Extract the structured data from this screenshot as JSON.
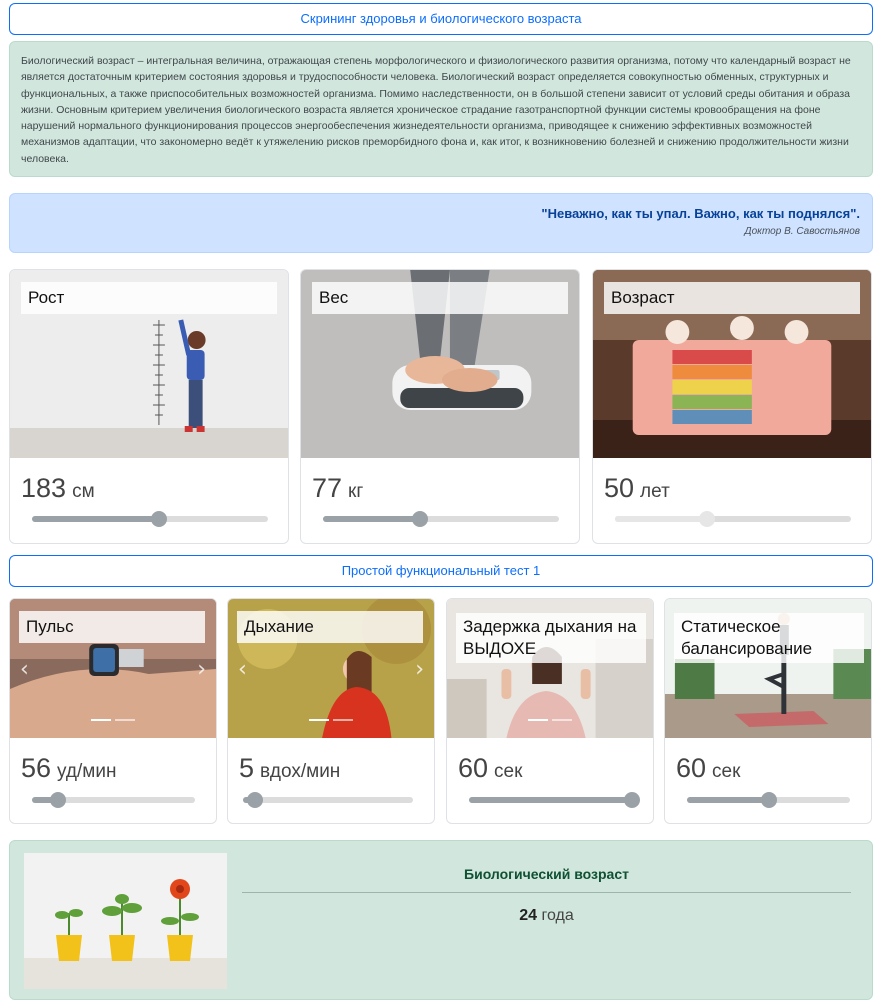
{
  "header": {
    "screening_button": "Скрининг здоровья и биологического возраста",
    "info_text": "Биологический возраст – интегральная величина, отражающая степень морфологического и физиологического развития организма, потому что календарный возраст не является достаточным критерием состояния здоровья и трудоспособности человека. Биологический возраст определяется совокупностью обменных, структурных и функциональных, а также приспособительных возможностей организма. Помимо наследственности, он в большой степени зависит от условий среды обитания и образа жизни. Основным критерием увеличения биологического возраста является хроническое страдание газотранспортной функции системы кровообращения на фоне нарушений нормального функционирования процессов энергообеспечения жизнедеятельности организма, приводящее к снижению эффективных возможностей механизмов адаптации, что закономерно ведёт к утяжелению рисков преморбидного фона и, как итог, к возникновению болезней и снижению продолжительности жизни человека."
  },
  "quote": {
    "text": "\"Неважно, как ты упал. Важно, как ты поднялся\".",
    "author": "Доктор В. Савостьянов"
  },
  "metrics": [
    {
      "label": "Рост",
      "value": "183",
      "unit": "см",
      "slider_fraction": 0.54,
      "image": "child-measuring-height-photo"
    },
    {
      "label": "Вес",
      "value": "77",
      "unit": "кг",
      "slider_fraction": 0.41,
      "image": "feet-on-scale-photo"
    },
    {
      "label": "Возраст",
      "value": "50",
      "unit": "лет",
      "slider_fraction": 0.39,
      "image": "rainbow-cake-photo"
    }
  ],
  "functional_test": {
    "button": "Простой функциональный тест 1",
    "items": [
      {
        "label": "Пульс",
        "value": "56",
        "unit": "уд/мин",
        "slider_fraction": 0.16,
        "image": "smartwatch-pulse-photo"
      },
      {
        "label": "Дыхание",
        "value": "5",
        "unit": "вдох/мин",
        "slider_fraction": 0.07,
        "image": "woman-breathing-photo"
      },
      {
        "label": "Задержка дыхания на ВЫДОХЕ",
        "value": "60",
        "unit": "сек",
        "slider_fraction": 1.0,
        "image": "woman-holding-breath-photo"
      },
      {
        "label": "Статическое балансирование",
        "value": "60",
        "unit": "сек",
        "slider_fraction": 0.5,
        "image": "yoga-balance-photo"
      }
    ]
  },
  "result": {
    "title": "Биологический возраст",
    "value": "24",
    "unit": "года",
    "image": "flowers-in-pots-photo"
  },
  "colors": {
    "primary": "#0d6efd",
    "success_bg": "#d1e7dd",
    "info_bg": "#cfe2ff",
    "slider": "#9aa2a8"
  }
}
